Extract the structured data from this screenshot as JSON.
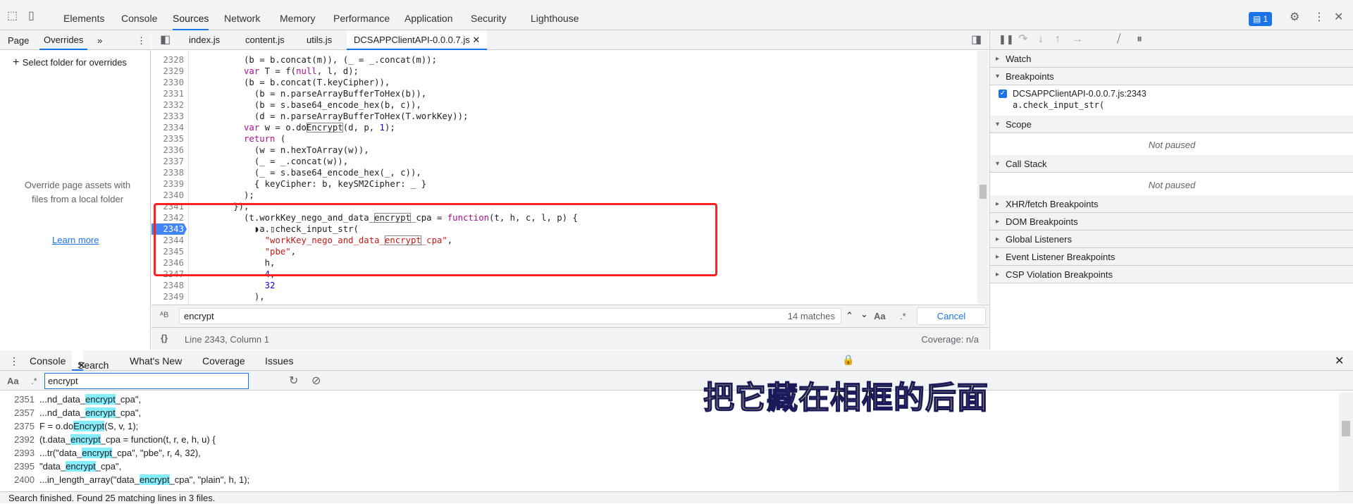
{
  "devtools_tabs": [
    "Elements",
    "Console",
    "Sources",
    "Network",
    "Memory",
    "Performance",
    "Application",
    "Security",
    "Lighthouse"
  ],
  "active_tab": "Sources",
  "issues_badge": "1",
  "left_panel": {
    "tabs": [
      "Page",
      "Overrides"
    ],
    "more": "»",
    "add_folder": "Select folder for overrides",
    "empty_text": "Override page assets with files from a local folder",
    "learn_more": "Learn more"
  },
  "file_tabs": [
    "index.js",
    "content.js",
    "utils.js",
    "DCSAPPClientAPI-0.0.0.7.js"
  ],
  "code_lines": [
    {
      "n": "2328",
      "t": [
        [
          "p",
          "          (b = b.concat(m)), (_ = _.concat(m));"
        ]
      ]
    },
    {
      "n": "2329",
      "t": [
        [
          "k",
          "          var"
        ],
        [
          "p",
          " T = f("
        ],
        [
          "k",
          "null"
        ],
        [
          "p",
          ", l, d);"
        ]
      ]
    },
    {
      "n": "2330",
      "t": [
        [
          "p",
          "          (b = b.concat(T.keyCipher)),"
        ]
      ]
    },
    {
      "n": "2331",
      "t": [
        [
          "p",
          "            (b = n.parseArrayBufferToHex(b)),"
        ]
      ]
    },
    {
      "n": "2332",
      "t": [
        [
          "p",
          "            (b = s.base64_encode_hex(b, c)),"
        ]
      ]
    },
    {
      "n": "2333",
      "t": [
        [
          "p",
          "            (d = n.parseArrayBufferToHex(T.workKey));"
        ]
      ]
    },
    {
      "n": "2334",
      "t": [
        [
          "k",
          "          var"
        ],
        [
          "p",
          " w = o.do"
        ],
        [
          "hl",
          "Encrypt"
        ],
        [
          "p",
          "(d, p, "
        ],
        [
          "n",
          "1"
        ],
        [
          "p",
          ");"
        ]
      ]
    },
    {
      "n": "2335",
      "t": [
        [
          "k",
          "          return"
        ],
        [
          "p",
          " ("
        ]
      ]
    },
    {
      "n": "2336",
      "t": [
        [
          "p",
          "            (w = n.hexToArray(w)),"
        ]
      ]
    },
    {
      "n": "2337",
      "t": [
        [
          "p",
          "            (_ = _.concat(w)),"
        ]
      ]
    },
    {
      "n": "2338",
      "t": [
        [
          "p",
          "            (_ = s.base64_encode_hex(_, c)),"
        ]
      ]
    },
    {
      "n": "2339",
      "t": [
        [
          "p",
          "            { keyCipher: b, keySM2Cipher: _ }"
        ]
      ]
    },
    {
      "n": "2340",
      "t": [
        [
          "p",
          "          );"
        ]
      ]
    },
    {
      "n": "2341",
      "t": [
        [
          "p",
          "        }),"
        ]
      ]
    },
    {
      "n": "2342",
      "t": [
        [
          "p",
          "          (t.workKey_nego_and_data_"
        ],
        [
          "hl",
          "encrypt"
        ],
        [
          "p",
          "_cpa = "
        ],
        [
          "k",
          "function"
        ],
        [
          "p",
          "(t, h, c, l, p) {"
        ]
      ]
    },
    {
      "n": "2343",
      "bp": true,
      "t": [
        [
          "p",
          "            ◗a.▯check_input_str("
        ]
      ]
    },
    {
      "n": "2344",
      "t": [
        [
          "s",
          "              \"workKey_nego_and_data_"
        ],
        [
          "hls",
          "encrypt"
        ],
        [
          "s",
          "_cpa\""
        ],
        [
          "p",
          ","
        ]
      ]
    },
    {
      "n": "2345",
      "t": [
        [
          "s",
          "              \"pbe\""
        ],
        [
          "p",
          ","
        ]
      ]
    },
    {
      "n": "2346",
      "t": [
        [
          "p",
          "              h,"
        ]
      ]
    },
    {
      "n": "2347",
      "t": [
        [
          "n",
          "              4"
        ],
        [
          "p",
          ","
        ]
      ]
    },
    {
      "n": "2348",
      "t": [
        [
          "n",
          "              32"
        ]
      ]
    },
    {
      "n": "2349",
      "t": [
        [
          "p",
          "            ),"
        ]
      ]
    }
  ],
  "find": {
    "query": "encrypt",
    "matches": "14 matches",
    "aa": "Aa",
    "regex": ".*",
    "cancel": "Cancel"
  },
  "status": {
    "position": "Line 2343, Column 1",
    "coverage": "Coverage: n/a"
  },
  "debugger": {
    "sections": [
      "Watch",
      "Breakpoints",
      "Scope",
      "Call Stack",
      "XHR/fetch Breakpoints",
      "DOM Breakpoints",
      "Global Listeners",
      "Event Listener Breakpoints",
      "CSP Violation Breakpoints"
    ],
    "breakpoint_file": "DCSAPPClientAPI-0.0.0.7.js:2343",
    "breakpoint_code": "a.check_input_str(",
    "not_paused": "Not paused"
  },
  "drawer": {
    "tabs": [
      "Console",
      "Search",
      "What's New",
      "Coverage",
      "Issues"
    ],
    "active": "Search",
    "search_value": "encrypt",
    "aa": "Aa",
    "regex": ".*",
    "results": [
      {
        "n": "2351",
        "pre": "...nd_data_",
        "m": "encrypt",
        "post": "_cpa\","
      },
      {
        "n": "2357",
        "pre": "...nd_data_",
        "m": "encrypt",
        "post": "_cpa\","
      },
      {
        "n": "2375",
        "pre": "F = o.do",
        "m": "Encrypt",
        "post": "(S, v, 1);"
      },
      {
        "n": "2392",
        "pre": "(t.data_",
        "m": "encrypt",
        "post": "_cpa = function(t, r, e, h, u) {"
      },
      {
        "n": "2393",
        "pre": "...tr(\"data_",
        "m": "encrypt",
        "post": "_cpa\", \"pbe\", r, 4, 32),"
      },
      {
        "n": "2395",
        "pre": "\"data_",
        "m": "encrypt",
        "post": "_cpa\","
      },
      {
        "n": "2400",
        "pre": "...in_length_array(\"data_",
        "m": "encrypt",
        "post": "_cpa\", \"plain\", h, 1);"
      }
    ],
    "status": "Search finished.  Found 25 matching lines in 3 files."
  },
  "caption": "把它藏在相框的后面"
}
